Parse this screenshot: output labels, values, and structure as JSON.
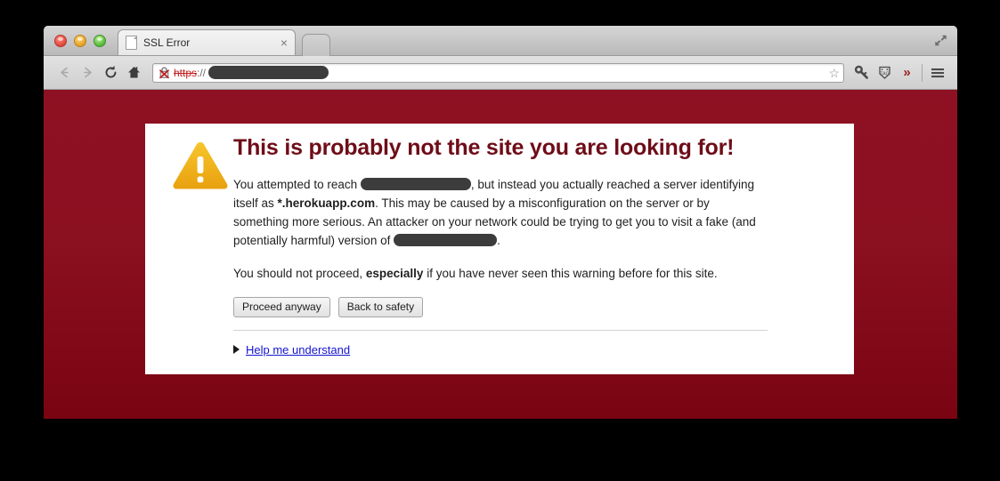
{
  "window": {
    "traffic_lights": [
      "close",
      "minimize",
      "maximize"
    ],
    "fullscreen_icon": "fullscreen-diagonal-arrows-icon"
  },
  "tabbar": {
    "tab_title": "SSL Error",
    "tab_close_label": "×",
    "favicon": "page-document-icon",
    "newtab_label": ""
  },
  "toolbar": {
    "back_label": "←",
    "forward_label": "→",
    "reload_label": "⟳",
    "home_label": "⌂",
    "url": {
      "scheme": "https",
      "separator": "://",
      "host_redacted": true,
      "ssl_state": "broken-https-padlock-with-red-x"
    },
    "star_label": "☆",
    "extension_icons": [
      "key-icon",
      "price-tag-icon"
    ],
    "overflow_label": "»",
    "menu_label": "☰"
  },
  "page": {
    "headline": "This is probably not the site you are looking for!",
    "paragraph1_part1": "You attempted to reach",
    "paragraph1_part2": ", but instead you actually reached a server identifying itself as",
    "server_name": "*.herokuapp.com",
    "paragraph1_part3": ". This may be caused by a misconfiguration on the server or by something more serious. An attacker on your network could be trying to get you to visit a fake (and potentially harmful) version of",
    "paragraph1_part4": ".",
    "paragraph2_part1": "You should not proceed,",
    "paragraph2_emphasis": "especially",
    "paragraph2_part2": "if you have never seen this warning before for this site.",
    "buttons": [
      {
        "label": "Proceed anyway",
        "name": "proceed-anyway-button"
      },
      {
        "label": "Back to safety",
        "name": "back-to-safety-button"
      }
    ],
    "help_link": "Help me understand",
    "warning_icon": "warning-triangle-icon"
  },
  "colors": {
    "page_background_top": "#8e1123",
    "page_background_bottom": "#7a0412",
    "headline": "#6e0d18",
    "warning_amber": "#f0b21c",
    "link_blue": "#1414d1",
    "redaction": "#3c3c3c",
    "ssl_red": "#c01c1c"
  }
}
